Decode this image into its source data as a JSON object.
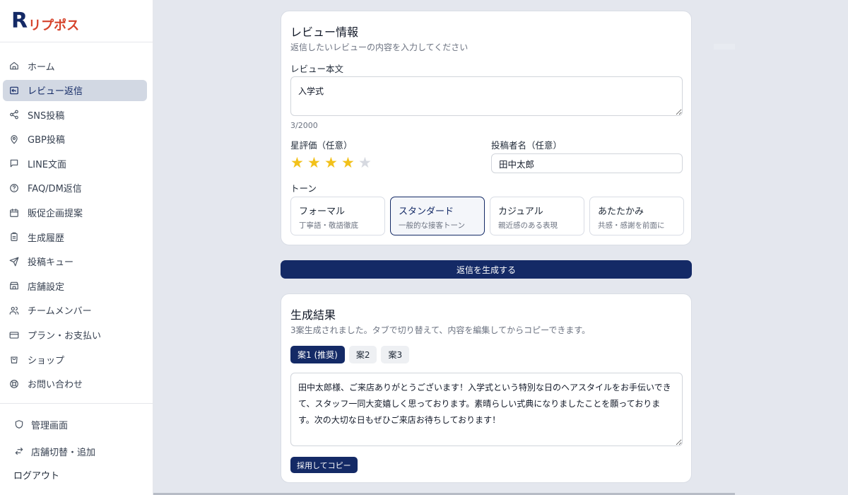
{
  "brand": {
    "letter": "R",
    "name": "リプポス"
  },
  "sidebar": {
    "items": [
      {
        "label": "ホーム",
        "icon": "home-icon"
      },
      {
        "label": "レビュー返信",
        "icon": "reply-icon",
        "active": true
      },
      {
        "label": "SNS投稿",
        "icon": "share-icon"
      },
      {
        "label": "GBP投稿",
        "icon": "map-pin-icon"
      },
      {
        "label": "LINE文面",
        "icon": "message-icon"
      },
      {
        "label": "FAQ/DM返信",
        "icon": "help-icon"
      },
      {
        "label": "販促企画提案",
        "icon": "calendar-icon"
      },
      {
        "label": "生成履歴",
        "icon": "clipboard-icon"
      },
      {
        "label": "投稿キュー",
        "icon": "send-icon"
      },
      {
        "label": "店舗設定",
        "icon": "store-icon"
      },
      {
        "label": "チームメンバー",
        "icon": "users-icon"
      },
      {
        "label": "プラン・お支払い",
        "icon": "credit-card-icon"
      },
      {
        "label": "ショップ",
        "icon": "shopping-bag-icon"
      },
      {
        "label": "お問い合わせ",
        "icon": "lifebuoy-icon"
      }
    ],
    "admin_label": "管理画面",
    "switch_label": "店舗切替・追加",
    "logout_label": "ログアウト"
  },
  "review": {
    "title": "レビュー情報",
    "subtitle": "返信したいレビューの内容を入力してください",
    "body_label": "レビュー本文",
    "body_value": "入学式",
    "counter": "3/2000",
    "rating_label": "星評価（任意）",
    "rating": 4,
    "rating_max": 5,
    "author_label": "投稿者名（任意）",
    "author_value": "田中太郎",
    "tone_label": "トーン",
    "tones": [
      {
        "name": "フォーマル",
        "desc": "丁寧語・敬語徹底"
      },
      {
        "name": "スタンダード",
        "desc": "一般的な接客トーン",
        "selected": true
      },
      {
        "name": "カジュアル",
        "desc": "親近感のある表現"
      },
      {
        "name": "あたたかみ",
        "desc": "共感・感謝を前面に"
      }
    ]
  },
  "generate_label": "返信を生成する",
  "result": {
    "title": "生成結果",
    "subtitle": "3案生成されました。タブで切り替えて、内容を編集してからコピーできます。",
    "tabs": [
      "案1 (推奨)",
      "案2",
      "案3"
    ],
    "active_tab": 0,
    "text": "田中太郎様、ご来店ありがとうございます！入学式という特別な日のヘアスタイルをお手伝いできて、スタッフ一同大変嬉しく思っております。素晴らしい式典になりましたことを願っております。次の大切な日もぜひご来店お待ちしております！",
    "copy_label": "採用してコピー"
  },
  "colors": {
    "primary": "#142a66",
    "accent": "#d6432b",
    "star": "#f2c11a"
  }
}
